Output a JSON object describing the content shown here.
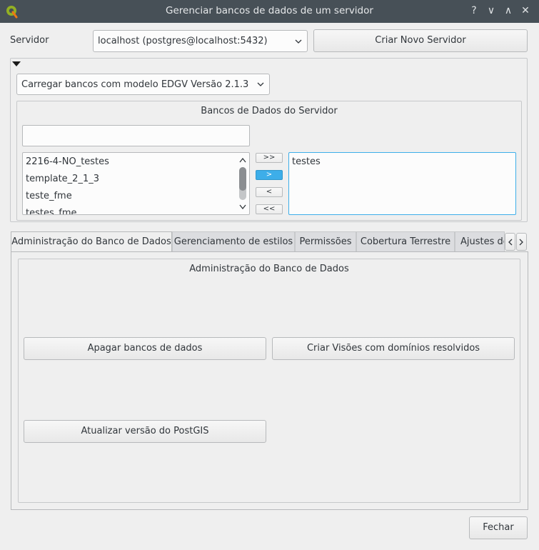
{
  "window": {
    "title": "Gerenciar bancos de dados de um servidor",
    "help_label": "?",
    "minimize_label": "∨",
    "maximize_label": "∧",
    "close_label": "✕"
  },
  "server": {
    "label": "Servidor",
    "selected": "localhost (postgres@localhost:5432)",
    "create_button": "Criar Novo Servidor"
  },
  "model_combo": {
    "selected": "Carregar bancos com modelo EDGV Versão 2.1.3"
  },
  "databases": {
    "title": "Bancos de Dados do Servidor",
    "filter_value": "",
    "available": [
      "2216-4-NO_testes",
      "template_2_1_3",
      "teste_fme",
      "testes_fme"
    ],
    "selected": [
      "testes"
    ],
    "buttons": {
      "add_all": ">>",
      "add": ">",
      "remove": "<",
      "remove_all": "<<"
    }
  },
  "tabs": [
    {
      "label": "Administração do Banco de Dados",
      "active": true
    },
    {
      "label": "Gerenciamento de estilos",
      "active": false
    },
    {
      "label": "Permissões",
      "active": false
    },
    {
      "label": "Cobertura Terrestre",
      "active": false
    },
    {
      "label": "Ajustes de",
      "active": false
    }
  ],
  "admin_panel": {
    "title": "Administração do Banco de Dados",
    "delete_button": "Apagar bancos de dados",
    "create_views_button": "Criar Visões com domínios resolvidos",
    "update_postgis_button": "Atualizar versão do PostGIS"
  },
  "footer": {
    "close_button": "Fechar"
  },
  "colors": {
    "titlebar": "#475057",
    "accent": "#3daee9",
    "background": "#efefef"
  }
}
